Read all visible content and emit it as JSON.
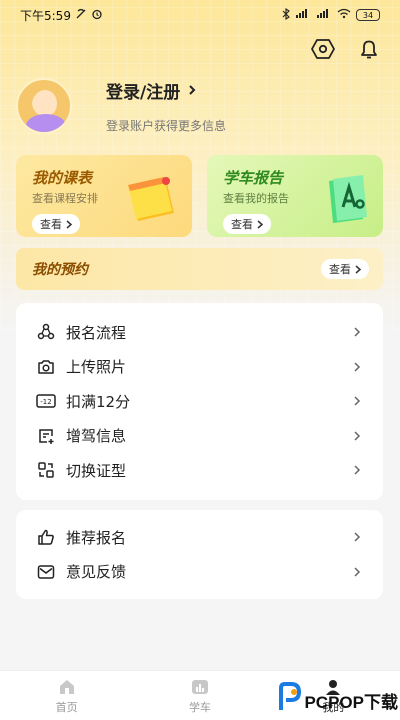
{
  "status_bar": {
    "time": "下午5:59",
    "battery": "34"
  },
  "header": {
    "icons": [
      "settings-hex-icon",
      "bell-icon"
    ]
  },
  "profile": {
    "title": "登录/注册",
    "subtitle": "登录账户获得更多信息"
  },
  "cards": {
    "course": {
      "title": "我的课表",
      "subtitle": "查看课程安排",
      "action": "查看"
    },
    "report": {
      "title": "学车报告",
      "subtitle": "查看我的报告",
      "action": "查看"
    }
  },
  "reservation": {
    "title": "我的预约",
    "action": "查看"
  },
  "menu_main": [
    {
      "label": "报名流程",
      "icon": "signup-flow-icon"
    },
    {
      "label": "上传照片",
      "icon": "camera-icon"
    },
    {
      "label": "扣满12分",
      "icon": "minus12-icon"
    },
    {
      "label": "增驾信息",
      "icon": "license-add-icon"
    },
    {
      "label": "切换证型",
      "icon": "switch-license-icon"
    }
  ],
  "menu_secondary": [
    {
      "label": "推荐报名",
      "icon": "thumbs-up-icon"
    },
    {
      "label": "意见反馈",
      "icon": "mail-icon"
    }
  ],
  "bottom_nav": [
    {
      "label": "首页",
      "icon": "home-icon"
    },
    {
      "label": "学车",
      "icon": "chart-icon"
    },
    {
      "label": "我的",
      "icon": "profile-icon"
    }
  ],
  "watermark": {
    "text": "PCPOP下载"
  }
}
